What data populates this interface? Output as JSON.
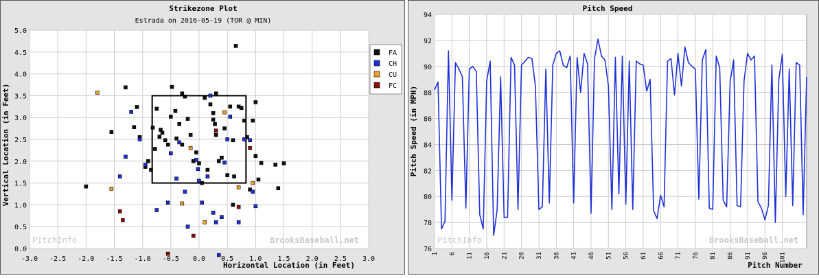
{
  "chart_data": [
    {
      "type": "scatter",
      "title": "Strikezone Plot",
      "subtitle": "Estrada on 2016-05-19 (TOR @ MIN)",
      "xlabel": "Horizontal Location (in Feet)",
      "ylabel": "Vertical Location (in Feet)",
      "xlim": [
        -3.0,
        3.0
      ],
      "ylim": [
        0.0,
        5.0
      ],
      "x_ticks": [
        "-3.0",
        "-2.5",
        "-2.0",
        "-1.5",
        "-1.0",
        "-0.5",
        "0.0",
        "0.5",
        "1.0",
        "1.5",
        "2.0",
        "2.5",
        "3.0"
      ],
      "y_ticks": [
        "0.0",
        "0.5",
        "1.0",
        "1.5",
        "2.0",
        "2.5",
        "3.0",
        "3.5",
        "4.0",
        "4.5",
        "5.0"
      ],
      "grid": true,
      "legend_position": "right",
      "strike_zone": {
        "x": [
          -0.83,
          0.83
        ],
        "y": [
          1.5,
          3.5
        ]
      },
      "watermark_left": "PitchInfo",
      "watermark_right": "BrooksBaseball.net",
      "series": [
        {
          "name": "FA",
          "color": "#111111",
          "points": [
            [
              -2.0,
              1.42
            ],
            [
              -1.55,
              2.67
            ],
            [
              -1.3,
              3.69
            ],
            [
              -1.15,
              2.78
            ],
            [
              -1.1,
              3.24
            ],
            [
              -1.05,
              2.55
            ],
            [
              -0.95,
              1.87
            ],
            [
              -0.9,
              2.0
            ],
            [
              -0.85,
              1.8
            ],
            [
              -0.82,
              2.77
            ],
            [
              -0.78,
              2.28
            ],
            [
              -0.75,
              3.2
            ],
            [
              -0.7,
              2.56
            ],
            [
              -0.68,
              2.72
            ],
            [
              -0.65,
              2.65
            ],
            [
              -0.6,
              2.48
            ],
            [
              -0.55,
              2.38
            ],
            [
              -0.5,
              3.02
            ],
            [
              -0.48,
              3.7
            ],
            [
              -0.42,
              3.15
            ],
            [
              -0.4,
              2.52
            ],
            [
              -0.35,
              2.85
            ],
            [
              -0.3,
              2.38
            ],
            [
              -0.3,
              3.55
            ],
            [
              -0.25,
              3.48
            ],
            [
              -0.2,
              2.97
            ],
            [
              -0.15,
              2.6
            ],
            [
              -0.1,
              2.0
            ],
            [
              -0.05,
              2.2
            ],
            [
              0.0,
              1.95
            ],
            [
              0.05,
              1.5
            ],
            [
              0.1,
              3.45
            ],
            [
              0.15,
              1.8
            ],
            [
              0.2,
              3.3
            ],
            [
              0.25,
              3.1
            ],
            [
              0.25,
              2.95
            ],
            [
              0.28,
              2.85
            ],
            [
              0.3,
              2.6
            ],
            [
              0.3,
              3.55
            ],
            [
              0.35,
              2.0
            ],
            [
              0.4,
              2.08
            ],
            [
              0.45,
              2.75
            ],
            [
              0.5,
              1.68
            ],
            [
              0.55,
              3.25
            ],
            [
              0.6,
              2.48
            ],
            [
              0.6,
              1.0
            ],
            [
              0.62,
              1.65
            ],
            [
              0.65,
              4.64
            ],
            [
              0.7,
              3.25
            ],
            [
              0.75,
              3.22
            ],
            [
              0.8,
              2.93
            ],
            [
              0.85,
              2.55
            ],
            [
              0.9,
              1.35
            ],
            [
              0.95,
              2.93
            ],
            [
              1.0,
              3.35
            ],
            [
              1.0,
              2.12
            ],
            [
              1.05,
              1.58
            ],
            [
              1.1,
              1.96
            ],
            [
              1.4,
              1.38
            ],
            [
              1.35,
              1.92
            ],
            [
              1.5,
              1.95
            ]
          ]
        },
        {
          "name": "CH",
          "color": "#1f30d8",
          "points": [
            [
              -1.4,
              1.65
            ],
            [
              -1.3,
              2.1
            ],
            [
              -1.2,
              3.13
            ],
            [
              -1.05,
              2.5
            ],
            [
              -0.95,
              1.92
            ],
            [
              -0.75,
              0.88
            ],
            [
              -0.55,
              1.05
            ],
            [
              -0.5,
              2.18
            ],
            [
              -0.4,
              1.6
            ],
            [
              -0.35,
              2.43
            ],
            [
              -0.25,
              1.3
            ],
            [
              -0.2,
              0.5
            ],
            [
              -0.05,
              2.03
            ],
            [
              -0.02,
              1.82
            ],
            [
              0.0,
              1.55
            ],
            [
              0.05,
              1.05
            ],
            [
              0.15,
              1.65
            ],
            [
              0.2,
              3.5
            ],
            [
              0.25,
              0.82
            ],
            [
              0.3,
              0.6
            ],
            [
              0.35,
              -0.15
            ],
            [
              0.4,
              0.72
            ],
            [
              0.45,
              1.97
            ],
            [
              0.5,
              2.5
            ],
            [
              0.55,
              3.02
            ],
            [
              0.7,
              0.6
            ],
            [
              0.8,
              2.5
            ],
            [
              0.9,
              2.48
            ],
            [
              0.95,
              1.3
            ],
            [
              1.0,
              0.97
            ]
          ]
        },
        {
          "name": "CU",
          "color": "#f0a030",
          "points": [
            [
              -1.8,
              3.57
            ],
            [
              -1.55,
              1.37
            ],
            [
              -0.3,
              1.03
            ],
            [
              -0.15,
              2.3
            ],
            [
              0.1,
              0.6
            ],
            [
              0.45,
              3.12
            ],
            [
              0.7,
              1.4
            ],
            [
              0.95,
              1.5
            ]
          ]
        },
        {
          "name": "FC",
          "color": "#8b1010",
          "points": [
            [
              -1.4,
              0.85
            ],
            [
              -1.35,
              0.65
            ],
            [
              -0.55,
              -0.12
            ],
            [
              -0.1,
              0.29
            ],
            [
              0.3,
              2.7
            ],
            [
              0.7,
              0.95
            ],
            [
              0.9,
              2.3
            ]
          ]
        }
      ]
    },
    {
      "type": "line",
      "title": "Pitch Speed",
      "xlabel": "Pitch Number",
      "ylabel": "Pitch Speed (in MPH)",
      "ylim": [
        76,
        94
      ],
      "y_ticks": [
        "76",
        "78",
        "80",
        "82",
        "84",
        "86",
        "88",
        "90",
        "92",
        "94"
      ],
      "x_ticks": [
        "1",
        "6",
        "11",
        "16",
        "21",
        "26",
        "31",
        "36",
        "41",
        "46",
        "51",
        "56",
        "61",
        "66",
        "71",
        "76",
        "81",
        "86",
        "91",
        "96",
        "101"
      ],
      "grid": true,
      "watermark_left": "PitchInfo",
      "watermark_right": "BrooksBaseball.net",
      "series": [
        {
          "name": "",
          "color": "#1f30d8",
          "values": [
            88.2,
            88.8,
            77.5,
            78.1,
            91.2,
            79.7,
            90.3,
            89.8,
            89.2,
            79.1,
            89.8,
            90.0,
            89.6,
            78.6,
            77.5,
            88.9,
            90.4,
            77.0,
            79.0,
            89.2,
            78.4,
            78.4,
            90.7,
            90.1,
            79.0,
            90.1,
            90.4,
            90.7,
            90.6,
            88.5,
            79.0,
            79.2,
            89.8,
            79.5,
            90.1,
            91.0,
            91.2,
            90.1,
            89.9,
            90.8,
            79.5,
            90.7,
            88.0,
            91.0,
            90.2,
            78.7,
            90.6,
            92.1,
            90.8,
            90.5,
            88.5,
            79.0,
            90.7,
            80.2,
            90.8,
            79.4,
            90.4,
            79.0,
            90.4,
            90.2,
            90.1,
            88.1,
            89.0,
            78.9,
            78.3,
            80.1,
            79.2,
            90.4,
            90.6,
            87.8,
            91.0,
            88.5,
            91.5,
            90.3,
            90.0,
            89.8,
            79.8,
            90.5,
            91.3,
            79.1,
            79.0,
            90.8,
            89.9,
            79.7,
            79.2,
            88.8,
            90.5,
            79.3,
            79.2,
            88.9,
            91.0,
            90.5,
            90.8,
            79.6,
            79.1,
            78.2,
            79.3,
            90.1,
            78.0,
            89.0,
            90.9,
            80.0,
            89.8,
            79.3,
            90.3,
            90.1,
            78.6,
            89.2
          ]
        }
      ]
    }
  ]
}
